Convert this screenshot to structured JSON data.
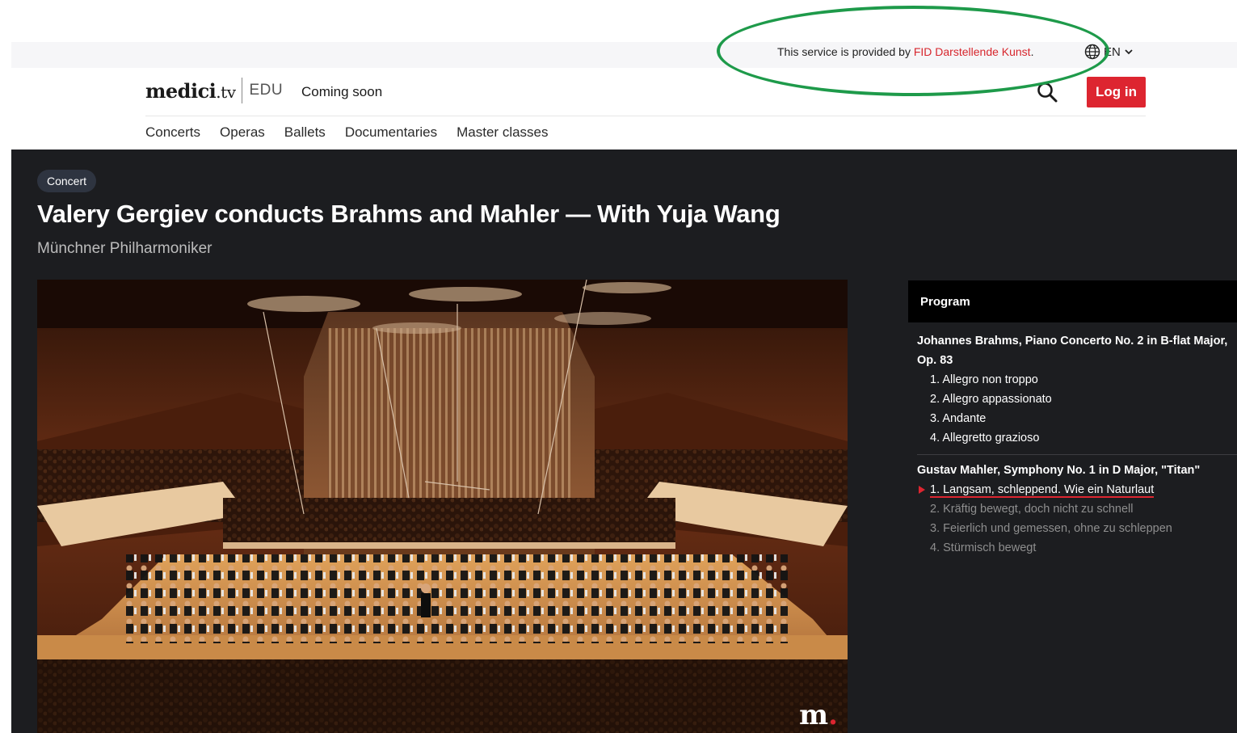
{
  "service_bar": {
    "prefix": "This service is provided by ",
    "link": "FID Darstellende Kunst",
    "suffix": ".",
    "language": "EN"
  },
  "header": {
    "brand": "medici",
    "brand_tv": ".tv",
    "brand_edu": "EDU",
    "coming_soon": "Coming soon",
    "login": "Log in"
  },
  "nav": {
    "items": [
      "Concerts",
      "Operas",
      "Ballets",
      "Documentaries",
      "Master classes"
    ]
  },
  "video_page": {
    "tag": "Concert",
    "title": "Valery Gergiev conducts Brahms and Mahler — With Yuja Wang",
    "subtitle": "Münchner Philharmoniker",
    "watermark": "m",
    "watermark_dot": "."
  },
  "program": {
    "heading": "Program",
    "works": [
      {
        "title": "Johannes Brahms, Piano Concerto No. 2 in B-flat Major, Op. 83",
        "movements": [
          {
            "label": "1. Allegro non troppo",
            "state": "done"
          },
          {
            "label": "2. Allegro appassionato",
            "state": "done"
          },
          {
            "label": "3. Andante",
            "state": "done"
          },
          {
            "label": "4. Allegretto grazioso",
            "state": "done"
          }
        ]
      },
      {
        "title": "Gustav Mahler, Symphony No. 1 in D Major, \"Titan\"",
        "movements": [
          {
            "label": "1. Langsam, schleppend. Wie ein Naturlaut",
            "state": "current"
          },
          {
            "label": "2. Kräftig bewegt, doch nicht zu schnell",
            "state": "upcoming"
          },
          {
            "label": "3. Feierlich und gemessen, ohne zu schleppen",
            "state": "upcoming"
          },
          {
            "label": "4. Stürmisch bewegt",
            "state": "upcoming"
          }
        ]
      }
    ]
  },
  "colors": {
    "accent": "#dd2530",
    "annotation": "#1e9a4a",
    "dark_bg": "#1c1d20"
  },
  "icons": {
    "language": "globe-icon",
    "language_dropdown": "chevron-down-icon",
    "search": "search-icon"
  }
}
